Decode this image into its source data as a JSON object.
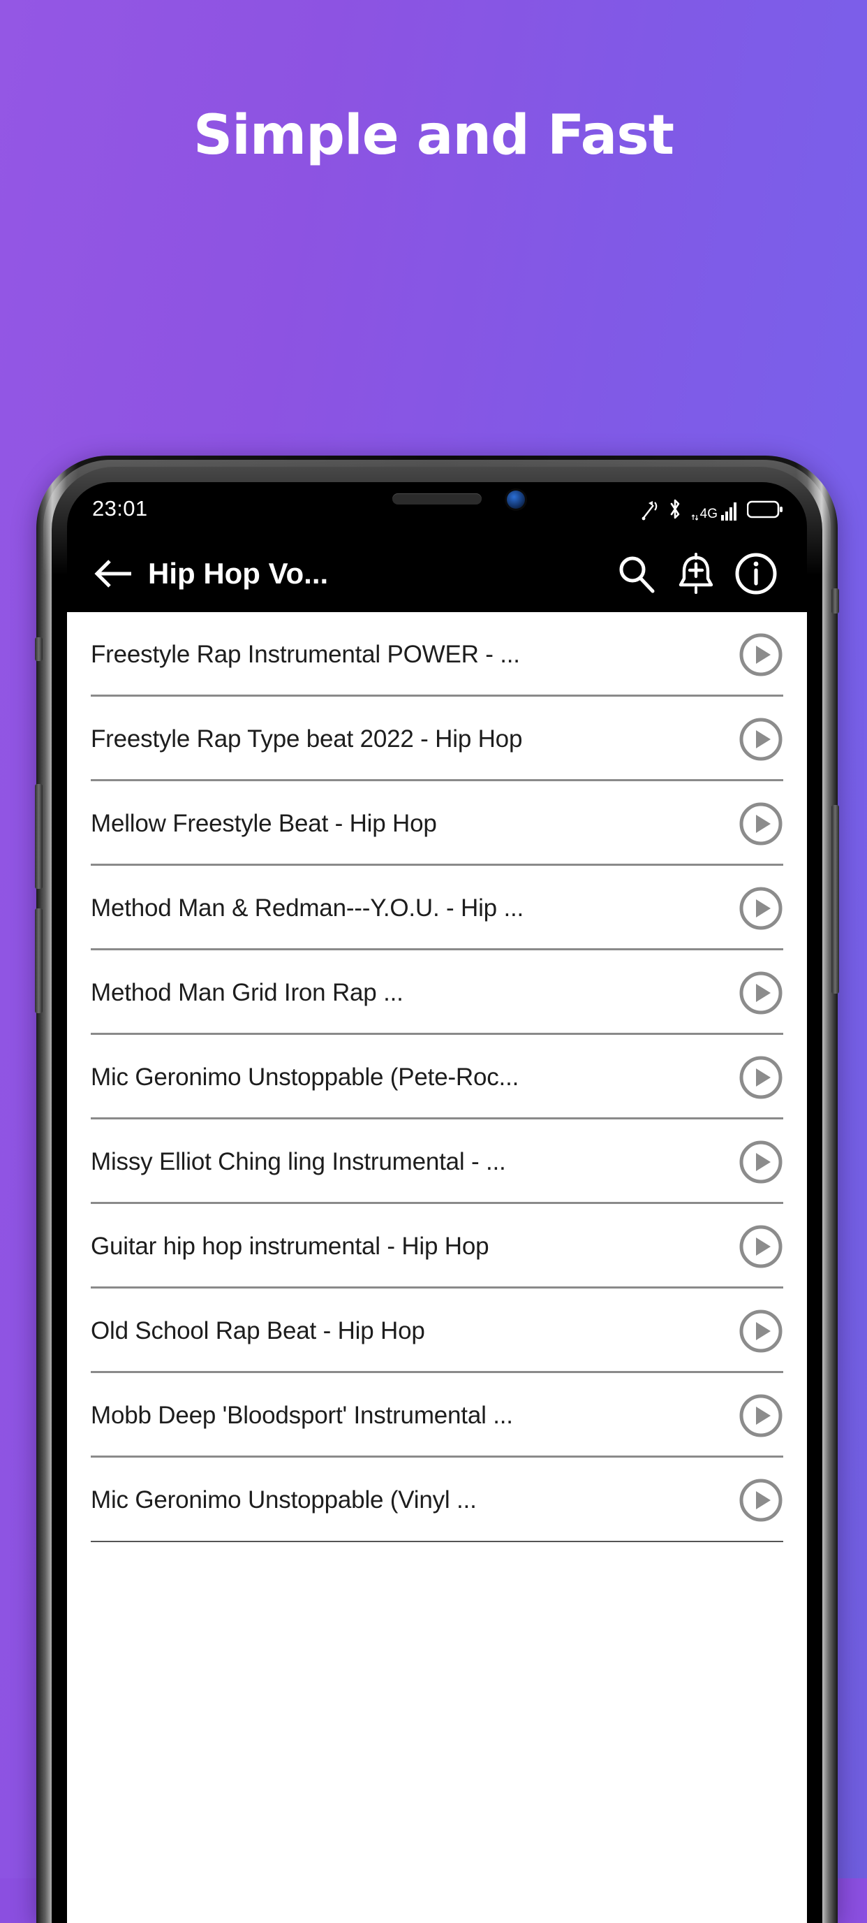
{
  "promo": {
    "headline": "Simple and Fast",
    "bg_color_left": "#9457e4",
    "bg_color_right": "#6f5ede",
    "headline_color": "#ffffff"
  },
  "phone": {
    "status_bar": {
      "time": "23:01",
      "icons": [
        "vibrate-signal-icon",
        "bluetooth-icon",
        "4g-signal-icon",
        "battery-icon"
      ],
      "network_label": "4G"
    },
    "app_bar": {
      "back_label": "back-arrow",
      "title": "Hip Hop Vo...",
      "actions": [
        {
          "name": "search-icon",
          "label": "Search"
        },
        {
          "name": "add-notification-icon",
          "label": "Add"
        },
        {
          "name": "info-icon",
          "label": "Info"
        }
      ]
    },
    "list": {
      "play_icon": "play-circle-icon",
      "items": [
        {
          "title": "Freestyle Rap Instrumental POWER - ..."
        },
        {
          "title": "Freestyle Rap Type beat 2022 - Hip Hop"
        },
        {
          "title": "Mellow Freestyle Beat - Hip Hop"
        },
        {
          "title": "Method Man & Redman---Y.O.U. - Hip ..."
        },
        {
          "title": "Method Man Grid Iron Rap ..."
        },
        {
          "title": "Mic Geronimo Unstoppable (Pete-Roc..."
        },
        {
          "title": "Missy Elliot Ching ling Instrumental - ..."
        },
        {
          "title": "Guitar hip hop instrumental - Hip Hop"
        },
        {
          "title": "Old School Rap Beat - Hip Hop"
        },
        {
          "title": "Mobb Deep 'Bloodsport' Instrumental ..."
        },
        {
          "title": "Mic Geronimo Unstoppable (Vinyl ..."
        }
      ]
    }
  }
}
